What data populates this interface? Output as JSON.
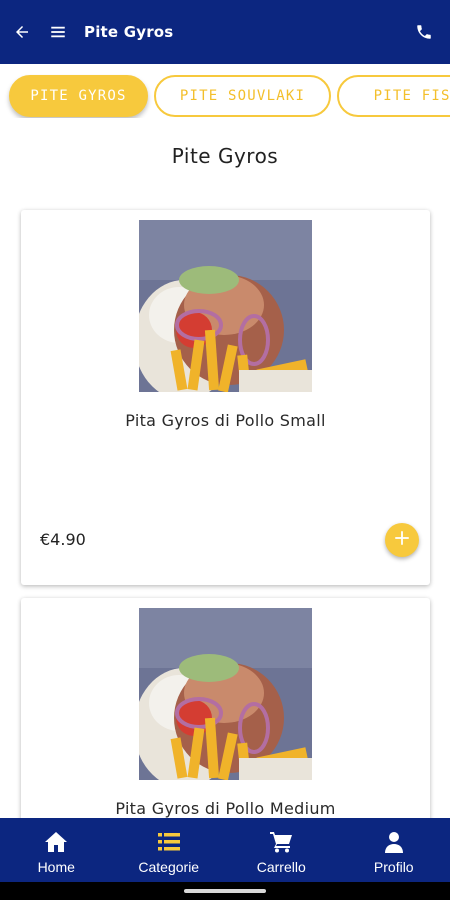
{
  "appbar": {
    "title": "Pite Gyros",
    "icons": [
      "back-arrow-icon",
      "menu-icon",
      "phone-icon"
    ],
    "color": "#0c2680"
  },
  "categories": [
    {
      "label": "PITE GYROS",
      "active": true
    },
    {
      "label": "PITE SOUVLAKI",
      "active": false
    },
    {
      "label": "PITE FISH",
      "active": false
    }
  ],
  "accent_color": "#f7c93d",
  "section_title": "Pite Gyros",
  "products": [
    {
      "name": "Pita Gyros di Pollo Small",
      "price": "€4.90",
      "add_icon": "plus-icon"
    },
    {
      "name": "Pita Gyros di Pollo Medium",
      "price": "",
      "add_icon": "plus-icon"
    }
  ],
  "bottom_nav": [
    {
      "label": "Home",
      "icon": "home-icon"
    },
    {
      "label": "Categorie",
      "icon": "list-icon",
      "active": true
    },
    {
      "label": "Carrello",
      "icon": "cart-icon"
    },
    {
      "label": "Profilo",
      "icon": "person-icon"
    }
  ]
}
